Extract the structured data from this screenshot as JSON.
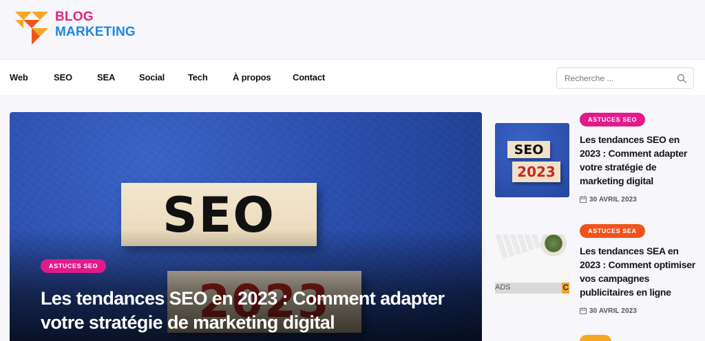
{
  "brand": {
    "line1": "BLOG",
    "line2": "MARKETING"
  },
  "colors": {
    "accent_pink": "#e31a8c",
    "accent_orange": "#f0531b",
    "accent_yellow": "#f5a623",
    "brand_blue": "#1e86e6"
  },
  "nav": {
    "items": [
      {
        "label": "Web"
      },
      {
        "label": "SEO"
      },
      {
        "label": "SEA"
      },
      {
        "label": "Social"
      },
      {
        "label": "Tech"
      },
      {
        "label": "À propos"
      },
      {
        "label": "Contact"
      }
    ]
  },
  "search": {
    "placeholder": "Recherche ...",
    "icon": "search-icon"
  },
  "hero": {
    "badge": "ASTUCES SEO",
    "title": "Les tendances SEO en 2023 : Comment adapter votre stratégie de marketing digital",
    "image_text_top": "SEO",
    "image_text_bottom": "2023"
  },
  "posts": [
    {
      "badge": "ASTUCES SEO",
      "title": "Les tendances SEO en 2023 : Comment adapter votre stratégie de marketing digital",
      "date": "30 AVRIL 2023",
      "thumb_text_top": "SEO",
      "thumb_text_bottom": "2023"
    },
    {
      "badge": "ASTUCES SEA",
      "title": "Les tendances SEA en 2023 : Comment optimiser vos campagnes publicitaires en ligne",
      "date": "30 AVRIL 2023",
      "thumb_text": "ADS",
      "thumb_text_right": "C"
    }
  ]
}
